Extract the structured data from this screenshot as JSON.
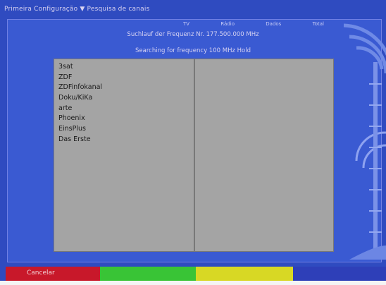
{
  "header": {
    "breadcrumb": "Primeira Configuração ▼ Pesquisa de canais"
  },
  "scan": {
    "column_headers": [
      "TV",
      "Rádio",
      "Dados",
      "Total"
    ],
    "frequency_de": "Suchlauf der Frequenz Nr. 177.500.000 MHz",
    "frequency_en": "Searching for frequency 100 MHz Hold"
  },
  "channels": [
    "3sat",
    "ZDF",
    "ZDFinfokanal",
    "Doku/KiKa",
    "arte",
    "Phoenix",
    "EinsPlus",
    "Das Erste"
  ],
  "function_keys": {
    "red_label": "Cancelar",
    "colors": {
      "red": "#c8182a",
      "green": "#39c436",
      "yellow": "#d8d824",
      "blue": "#2e3fb8"
    }
  },
  "theme": {
    "background": "#2f4bc0",
    "list_background": "#a4a4a4"
  },
  "icons": [
    "signal-waves-icon"
  ]
}
